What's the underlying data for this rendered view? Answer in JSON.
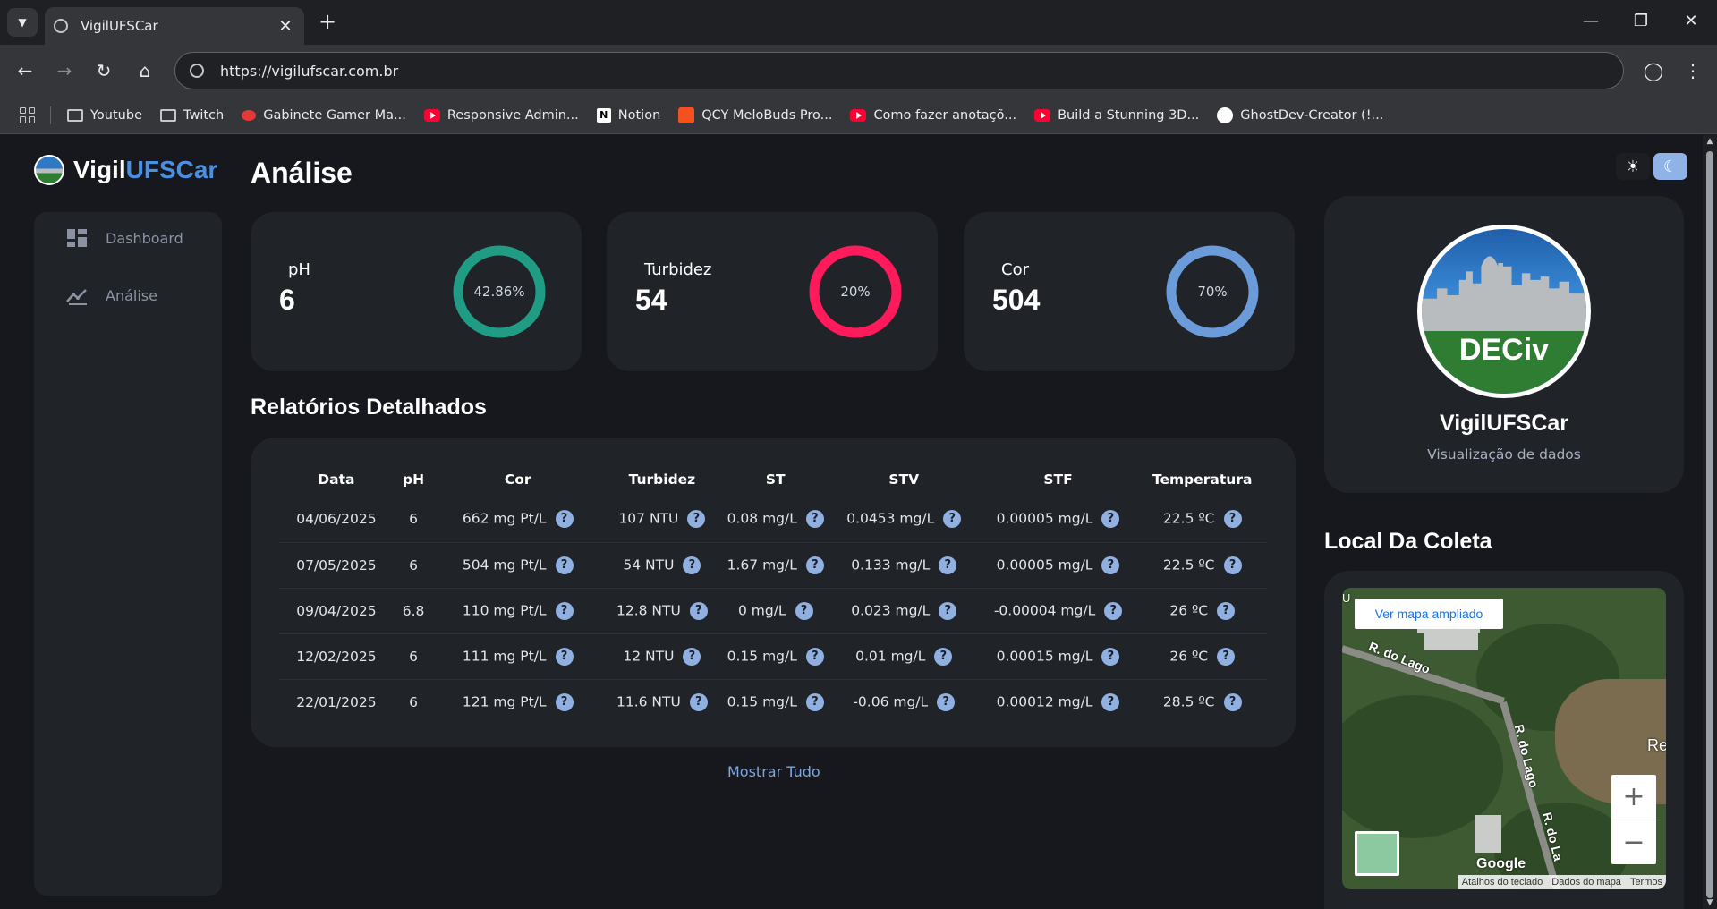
{
  "browser": {
    "tab_title": "VigilUFSCar",
    "url": "https://vigilufscar.com.br",
    "bookmarks": [
      {
        "label": "Youtube",
        "icon": "folder-icon"
      },
      {
        "label": "Twitch",
        "icon": "folder-icon"
      },
      {
        "label": "Gabinete Gamer Ma...",
        "icon": "store-icon"
      },
      {
        "label": "Responsive Admin...",
        "icon": "youtube-icon"
      },
      {
        "label": "Notion",
        "icon": "notion-icon"
      },
      {
        "label": "QCY MeloBuds Pro...",
        "icon": "store-icon"
      },
      {
        "label": "Como fazer anotaçõ...",
        "icon": "youtube-icon"
      },
      {
        "label": "Build a Stunning 3D...",
        "icon": "youtube-icon"
      },
      {
        "label": "GhostDev-Creator (!...",
        "icon": "github-icon"
      }
    ]
  },
  "brand": {
    "prefix": "Vigil",
    "accent": "UFSCar"
  },
  "sidebar": {
    "items": [
      {
        "label": "Dashboard",
        "icon": "dashboard-icon"
      },
      {
        "label": "Análise",
        "icon": "analytics-icon"
      }
    ]
  },
  "page": {
    "title": "Análise"
  },
  "stats": [
    {
      "label": "pH",
      "value": "6",
      "percent_label": "42.86%",
      "percent": 100,
      "color": "#1f9c83"
    },
    {
      "label": "Turbidez",
      "value": "54",
      "percent_label": "20%",
      "percent": 100,
      "color": "#ff1a5c"
    },
    {
      "label": "Cor",
      "value": "504",
      "percent_label": "70%",
      "percent": 100,
      "color": "#6b9bd8"
    }
  ],
  "reports": {
    "title": "Relatórios Detalhados",
    "columns": [
      "Data",
      "pH",
      "Cor",
      "Turbidez",
      "ST",
      "STV",
      "STF",
      "Temperatura"
    ],
    "rows": [
      [
        "04/06/2025",
        "6",
        "662 mg Pt/L",
        "107 NTU",
        "0.08 mg/L",
        "0.0453 mg/L",
        "0.00005 mg/L",
        "22.5 ºC"
      ],
      [
        "07/05/2025",
        "6",
        "504 mg Pt/L",
        "54 NTU",
        "1.67 mg/L",
        "0.133 mg/L",
        "0.00005 mg/L",
        "22.5 ºC"
      ],
      [
        "09/04/2025",
        "6.8",
        "110 mg Pt/L",
        "12.8 NTU",
        "0 mg/L",
        "0.023 mg/L",
        "-0.00004 mg/L",
        "26 ºC"
      ],
      [
        "12/02/2025",
        "6",
        "111 mg Pt/L",
        "12 NTU",
        "0.15 mg/L",
        "0.01 mg/L",
        "0.00015 mg/L",
        "26 ºC"
      ],
      [
        "22/01/2025",
        "6",
        "121 mg Pt/L",
        "11.6 NTU",
        "0.15 mg/L",
        "-0.06 mg/L",
        "0.00012 mg/L",
        "28.5 ºC"
      ]
    ],
    "help_glyph": "?",
    "show_all": "Mostrar Tudo"
  },
  "profile": {
    "logo_text": "DECiv",
    "name": "VigilUFSCar",
    "subtitle": "Visualização de dados"
  },
  "map": {
    "title": "Local Da Coleta",
    "open_link": "Ver mapa ampliado",
    "roads": [
      "R. do Lago",
      "R. do Lago",
      "R. do La"
    ],
    "partial_labels": [
      "U",
      "Re"
    ],
    "google": "Google",
    "attribution": [
      "Atalhos do teclado",
      "Dados do mapa",
      "Termos"
    ],
    "zoom_in": "+",
    "zoom_out": "−"
  }
}
